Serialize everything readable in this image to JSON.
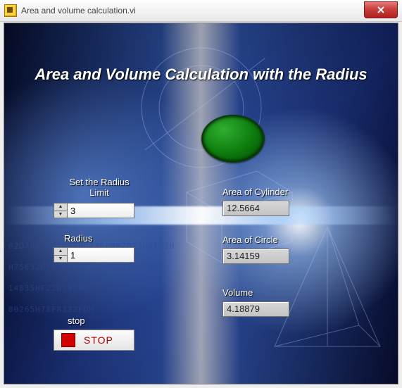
{
  "window": {
    "title": "Area and volume calculation.vi"
  },
  "heading": "Area and Volume Calculation with the Radius",
  "led": {
    "name": "status-led",
    "on": true,
    "color": "#0c7a0c"
  },
  "inputs": {
    "radius_limit": {
      "label": "Set the Radius Limit",
      "value": "3"
    },
    "radius": {
      "label": "Radius",
      "value": "1"
    }
  },
  "outputs": {
    "area_cylinder": {
      "label": "Area of Cylinder",
      "value": "12.5664"
    },
    "area_circle": {
      "label": "Area of Circle",
      "value": "3.14159"
    },
    "volume": {
      "label": "Volume",
      "value": "4.18879"
    }
  },
  "stop": {
    "label": "stop",
    "button_text": "STOP"
  },
  "bg_noise": [
    "02D7HG3662DF7HD236cH87D2366123H",
    "H75632D68nDH7D236cH87236FD8H7",
    "14835HF23D587H87",
    "00265H78FR3ZZFDH"
  ]
}
